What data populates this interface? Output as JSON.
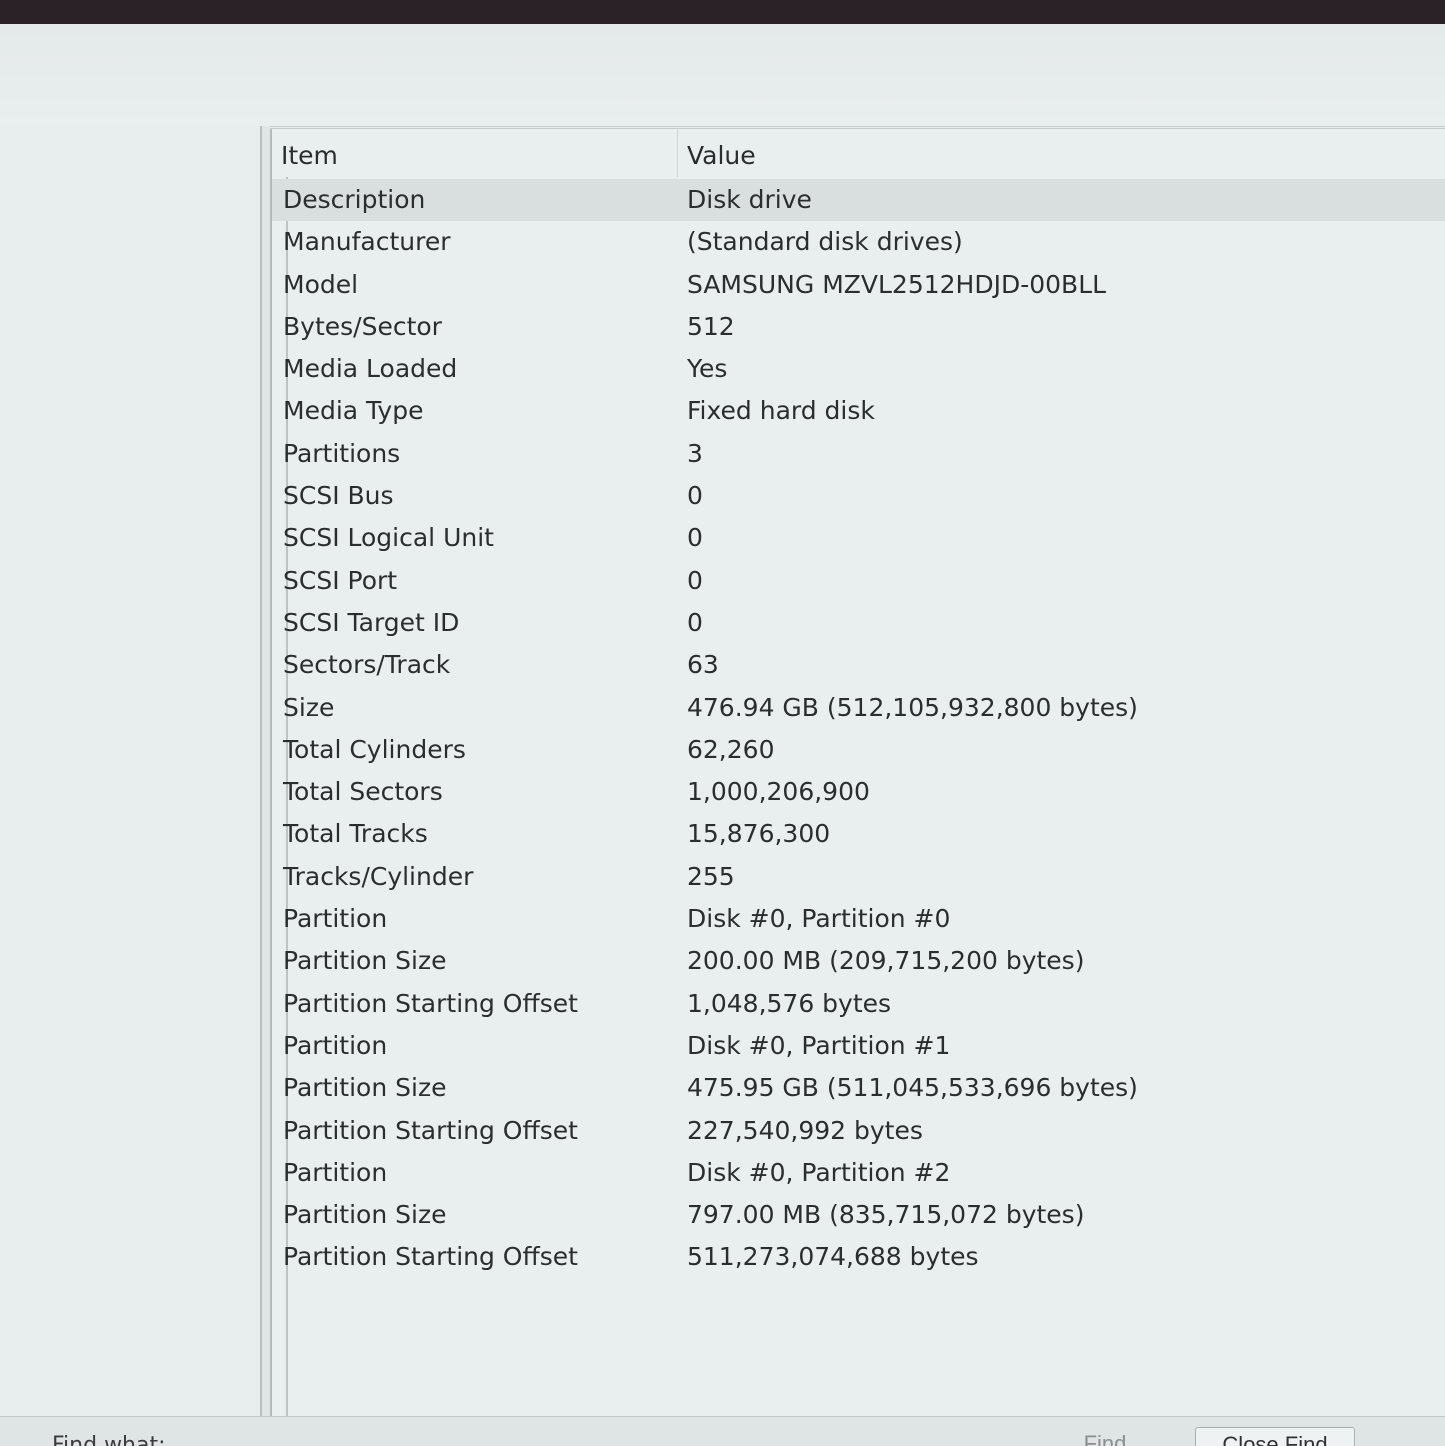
{
  "header": {
    "item": "Item",
    "value": "Value"
  },
  "rows": [
    {
      "item": "Description",
      "value": "Disk drive",
      "selected": true
    },
    {
      "item": "Manufacturer",
      "value": "(Standard disk drives)"
    },
    {
      "item": "Model",
      "value": "SAMSUNG MZVL2512HDJD-00BLL"
    },
    {
      "item": "Bytes/Sector",
      "value": "512"
    },
    {
      "item": "Media Loaded",
      "value": "Yes"
    },
    {
      "item": "Media Type",
      "value": "Fixed hard disk"
    },
    {
      "item": "Partitions",
      "value": "3"
    },
    {
      "item": "SCSI Bus",
      "value": "0"
    },
    {
      "item": "SCSI Logical Unit",
      "value": "0"
    },
    {
      "item": "SCSI Port",
      "value": "0"
    },
    {
      "item": "SCSI Target ID",
      "value": "0"
    },
    {
      "item": "Sectors/Track",
      "value": "63"
    },
    {
      "item": "Size",
      "value": "476.94 GB (512,105,932,800 bytes)"
    },
    {
      "item": "Total Cylinders",
      "value": "62,260"
    },
    {
      "item": "Total Sectors",
      "value": "1,000,206,900"
    },
    {
      "item": "Total Tracks",
      "value": "15,876,300"
    },
    {
      "item": "Tracks/Cylinder",
      "value": "255"
    },
    {
      "item": "Partition",
      "value": "Disk #0, Partition #0"
    },
    {
      "item": "Partition Size",
      "value": "200.00 MB (209,715,200 bytes)"
    },
    {
      "item": "Partition Starting Offset",
      "value": "1,048,576 bytes"
    },
    {
      "item": "Partition",
      "value": "Disk #0, Partition #1"
    },
    {
      "item": "Partition Size",
      "value": "475.95 GB (511,045,533,696 bytes)"
    },
    {
      "item": "Partition Starting Offset",
      "value": "227,540,992 bytes"
    },
    {
      "item": "Partition",
      "value": "Disk #0, Partition #2"
    },
    {
      "item": "Partition Size",
      "value": "797.00 MB (835,715,072 bytes)"
    },
    {
      "item": "Partition Starting Offset",
      "value": "511,273,074,688 bytes"
    }
  ],
  "statusbar": {
    "find_label": "Find what:",
    "find_button": "Find",
    "close_find_button": "Close Find"
  }
}
